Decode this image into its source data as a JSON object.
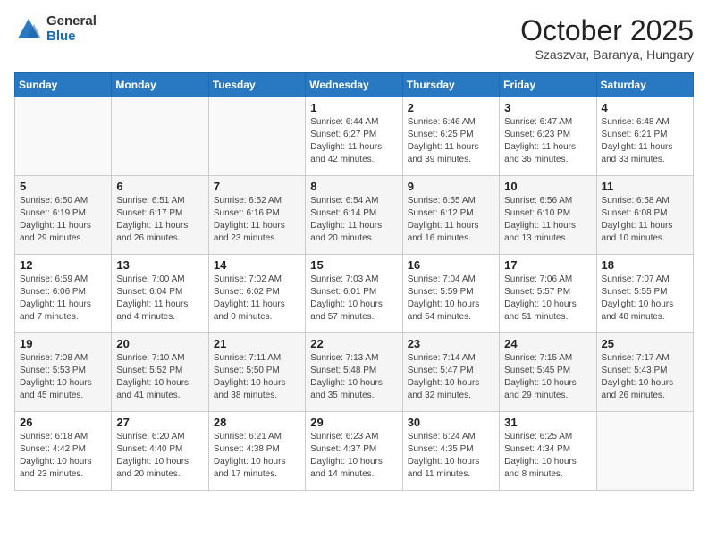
{
  "logo": {
    "general": "General",
    "blue": "Blue"
  },
  "header": {
    "month": "October 2025",
    "location": "Szaszvar, Baranya, Hungary"
  },
  "weekdays": [
    "Sunday",
    "Monday",
    "Tuesday",
    "Wednesday",
    "Thursday",
    "Friday",
    "Saturday"
  ],
  "weeks": [
    [
      {
        "day": null,
        "info": null
      },
      {
        "day": null,
        "info": null
      },
      {
        "day": null,
        "info": null
      },
      {
        "day": "1",
        "info": "Sunrise: 6:44 AM\nSunset: 6:27 PM\nDaylight: 11 hours\nand 42 minutes."
      },
      {
        "day": "2",
        "info": "Sunrise: 6:46 AM\nSunset: 6:25 PM\nDaylight: 11 hours\nand 39 minutes."
      },
      {
        "day": "3",
        "info": "Sunrise: 6:47 AM\nSunset: 6:23 PM\nDaylight: 11 hours\nand 36 minutes."
      },
      {
        "day": "4",
        "info": "Sunrise: 6:48 AM\nSunset: 6:21 PM\nDaylight: 11 hours\nand 33 minutes."
      }
    ],
    [
      {
        "day": "5",
        "info": "Sunrise: 6:50 AM\nSunset: 6:19 PM\nDaylight: 11 hours\nand 29 minutes."
      },
      {
        "day": "6",
        "info": "Sunrise: 6:51 AM\nSunset: 6:17 PM\nDaylight: 11 hours\nand 26 minutes."
      },
      {
        "day": "7",
        "info": "Sunrise: 6:52 AM\nSunset: 6:16 PM\nDaylight: 11 hours\nand 23 minutes."
      },
      {
        "day": "8",
        "info": "Sunrise: 6:54 AM\nSunset: 6:14 PM\nDaylight: 11 hours\nand 20 minutes."
      },
      {
        "day": "9",
        "info": "Sunrise: 6:55 AM\nSunset: 6:12 PM\nDaylight: 11 hours\nand 16 minutes."
      },
      {
        "day": "10",
        "info": "Sunrise: 6:56 AM\nSunset: 6:10 PM\nDaylight: 11 hours\nand 13 minutes."
      },
      {
        "day": "11",
        "info": "Sunrise: 6:58 AM\nSunset: 6:08 PM\nDaylight: 11 hours\nand 10 minutes."
      }
    ],
    [
      {
        "day": "12",
        "info": "Sunrise: 6:59 AM\nSunset: 6:06 PM\nDaylight: 11 hours\nand 7 minutes."
      },
      {
        "day": "13",
        "info": "Sunrise: 7:00 AM\nSunset: 6:04 PM\nDaylight: 11 hours\nand 4 minutes."
      },
      {
        "day": "14",
        "info": "Sunrise: 7:02 AM\nSunset: 6:02 PM\nDaylight: 11 hours\nand 0 minutes."
      },
      {
        "day": "15",
        "info": "Sunrise: 7:03 AM\nSunset: 6:01 PM\nDaylight: 10 hours\nand 57 minutes."
      },
      {
        "day": "16",
        "info": "Sunrise: 7:04 AM\nSunset: 5:59 PM\nDaylight: 10 hours\nand 54 minutes."
      },
      {
        "day": "17",
        "info": "Sunrise: 7:06 AM\nSunset: 5:57 PM\nDaylight: 10 hours\nand 51 minutes."
      },
      {
        "day": "18",
        "info": "Sunrise: 7:07 AM\nSunset: 5:55 PM\nDaylight: 10 hours\nand 48 minutes."
      }
    ],
    [
      {
        "day": "19",
        "info": "Sunrise: 7:08 AM\nSunset: 5:53 PM\nDaylight: 10 hours\nand 45 minutes."
      },
      {
        "day": "20",
        "info": "Sunrise: 7:10 AM\nSunset: 5:52 PM\nDaylight: 10 hours\nand 41 minutes."
      },
      {
        "day": "21",
        "info": "Sunrise: 7:11 AM\nSunset: 5:50 PM\nDaylight: 10 hours\nand 38 minutes."
      },
      {
        "day": "22",
        "info": "Sunrise: 7:13 AM\nSunset: 5:48 PM\nDaylight: 10 hours\nand 35 minutes."
      },
      {
        "day": "23",
        "info": "Sunrise: 7:14 AM\nSunset: 5:47 PM\nDaylight: 10 hours\nand 32 minutes."
      },
      {
        "day": "24",
        "info": "Sunrise: 7:15 AM\nSunset: 5:45 PM\nDaylight: 10 hours\nand 29 minutes."
      },
      {
        "day": "25",
        "info": "Sunrise: 7:17 AM\nSunset: 5:43 PM\nDaylight: 10 hours\nand 26 minutes."
      }
    ],
    [
      {
        "day": "26",
        "info": "Sunrise: 6:18 AM\nSunset: 4:42 PM\nDaylight: 10 hours\nand 23 minutes."
      },
      {
        "day": "27",
        "info": "Sunrise: 6:20 AM\nSunset: 4:40 PM\nDaylight: 10 hours\nand 20 minutes."
      },
      {
        "day": "28",
        "info": "Sunrise: 6:21 AM\nSunset: 4:38 PM\nDaylight: 10 hours\nand 17 minutes."
      },
      {
        "day": "29",
        "info": "Sunrise: 6:23 AM\nSunset: 4:37 PM\nDaylight: 10 hours\nand 14 minutes."
      },
      {
        "day": "30",
        "info": "Sunrise: 6:24 AM\nSunset: 4:35 PM\nDaylight: 10 hours\nand 11 minutes."
      },
      {
        "day": "31",
        "info": "Sunrise: 6:25 AM\nSunset: 4:34 PM\nDaylight: 10 hours\nand 8 minutes."
      },
      {
        "day": null,
        "info": null
      }
    ]
  ]
}
